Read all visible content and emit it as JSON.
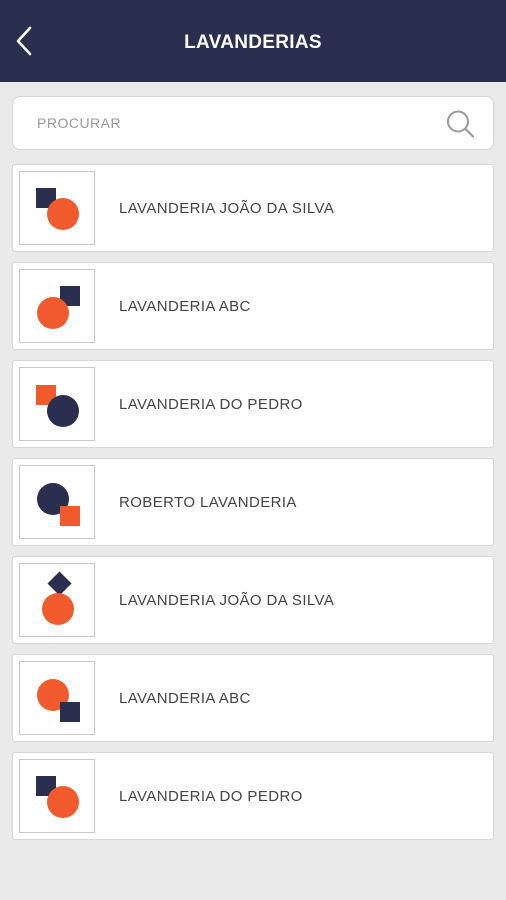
{
  "header": {
    "title": "LAVANDERIAS"
  },
  "search": {
    "placeholder": "PROCURAR"
  },
  "colors": {
    "navy": "#2b2f4f",
    "orange": "#f05a2c"
  },
  "items": [
    {
      "name": "LAVANDERIA JOÃO DA SILVA",
      "logo": "square-top-left-circle-bottom-right"
    },
    {
      "name": "LAVANDERIA ABC",
      "logo": "circle-bottom-left-square-top-right"
    },
    {
      "name": "LAVANDERIA DO PEDRO",
      "logo": "orange-square-navy-circle"
    },
    {
      "name": "ROBERTO LAVANDERIA",
      "logo": "navy-circle-orange-square"
    },
    {
      "name": "LAVANDERIA JOÃO DA SILVA",
      "logo": "diamond-over-circle"
    },
    {
      "name": "LAVANDERIA ABC",
      "logo": "orange-circle-navy-square"
    },
    {
      "name": "LAVANDERIA DO PEDRO",
      "logo": "square-top-left-circle-bottom-right"
    }
  ]
}
